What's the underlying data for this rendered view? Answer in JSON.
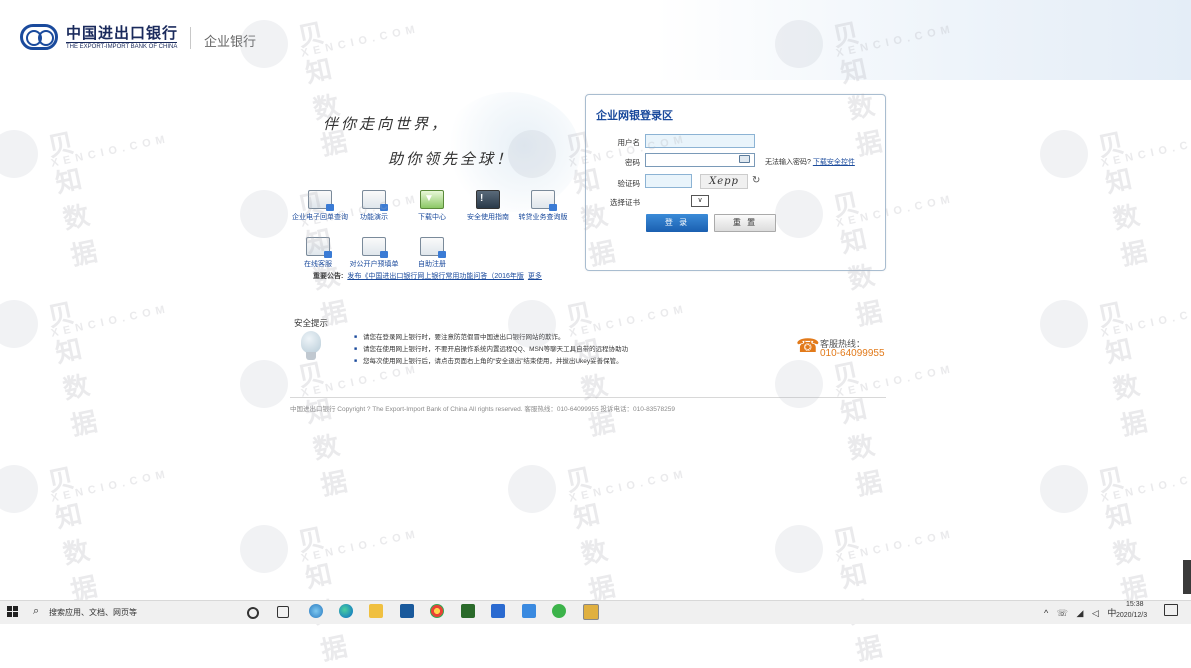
{
  "header": {
    "bank_name_cn": "中国进出口银行",
    "bank_name_en": "THE EXPORT-IMPORT BANK OF CHINA",
    "title": "企业银行"
  },
  "slogan": {
    "line1": "伴你走向世界，",
    "line2": "助你领先全球！"
  },
  "quick_links": [
    {
      "label": "企业电子回单查询",
      "icon": "receipt-icon"
    },
    {
      "label": "功能演示",
      "icon": "film-icon"
    },
    {
      "label": "下载中心",
      "icon": "download-icon"
    },
    {
      "label": "安全使用指南",
      "icon": "warning-icon"
    },
    {
      "label": "转贷业务查询版",
      "icon": "document-icon"
    },
    {
      "label": "在线客服",
      "icon": "chat-icon"
    },
    {
      "label": "对公开户预填单",
      "icon": "form-icon"
    },
    {
      "label": "自助注册",
      "icon": "register-icon"
    }
  ],
  "notice": {
    "label": "重要公告:",
    "text": "发布《中国进出口银行网上银行常用功能问答（2016年版",
    "more": "更多"
  },
  "login": {
    "title": "企业网银登录区",
    "username_label": "用户名",
    "password_label": "密码",
    "password_hint": "无法输入密码?",
    "download_link": "下载安全控件",
    "captcha_label": "验证码",
    "captcha_text": "Xepp",
    "certificate_label": "选择证书",
    "login_button": "登 录",
    "reset_button": "重 置"
  },
  "security": {
    "title": "安全提示",
    "tips": [
      "请您在登录网上银行时，要注意防范假冒中国进出口银行网站的欺诈。",
      "请您在使用网上银行时，不要开启操作系统内置远程QQ、MSN等聊天工具自带的远程协助功",
      "您每次使用网上银行后，请点击页面右上角的“安全退出”结束使用，并拔出Ukey妥善保管。"
    ]
  },
  "hotline": {
    "label": "客服热线：",
    "number": "010-64099955"
  },
  "footer": {
    "text": "中国进出口银行 Copyright ? The Export-Import Bank of China All rights reserved.    客服热线：010-64099955    投诉电话：010-83578259"
  },
  "taskbar": {
    "search_placeholder": "搜索应用、文档、网页等",
    "tray_text": "^ ☏ ◢ ◁ 中",
    "time": "15:38",
    "date": "2020/12/3"
  },
  "watermark": {
    "cn": "贝知数据",
    "en": "XENCIO.COM"
  },
  "colors": {
    "brand_blue": "#1a4a9c",
    "hotline_orange": "#e27a1a"
  }
}
